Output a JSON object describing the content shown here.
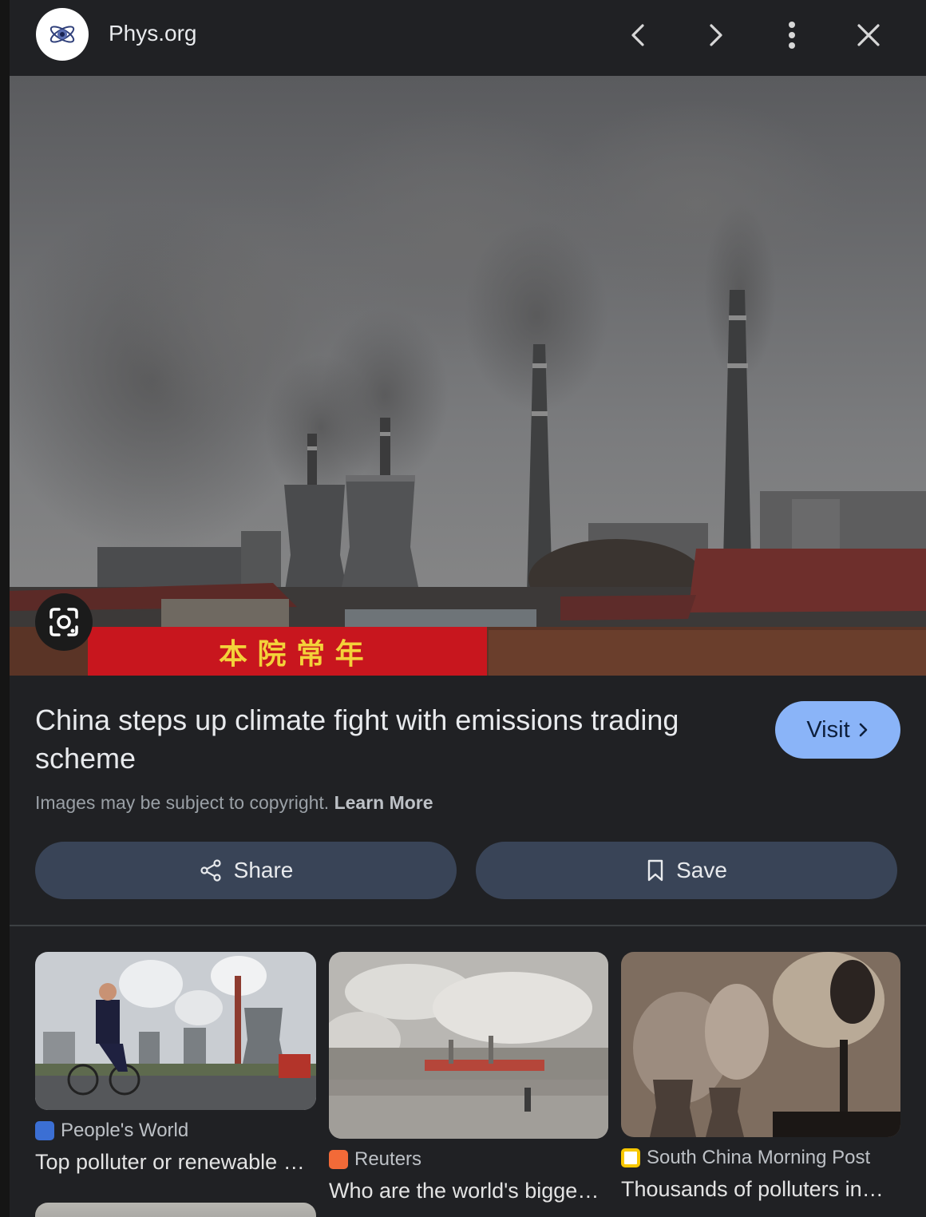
{
  "header": {
    "site_name": "Phys.org",
    "buttons": [
      "chevron-left-icon",
      "chevron-right-icon",
      "more-vert-icon",
      "close-icon"
    ]
  },
  "hero": {
    "banner_text": "本 院 常 年"
  },
  "result": {
    "title": "China steps up climate fight with emissions trading scheme",
    "visit_label": "Visit",
    "copyright_text": "Images may be subject to copyright.",
    "learn_more_label": "Learn More",
    "share_label": "Share",
    "save_label": "Save"
  },
  "related": [
    {
      "source": "People's World",
      "title": "Top polluter or renewable energy leader? China..."
    },
    {
      "source": "Reuters",
      "title": "Who are the world's biggest polluters?"
    },
    {
      "source": "South China Morning Post",
      "title": "Thousands of polluters in China..."
    }
  ],
  "colors": {
    "background": "#202124",
    "accent": "#8ab4f8",
    "button_bg": "#394457",
    "banner_red": "#c8161e",
    "banner_text": "#f3d23a"
  }
}
